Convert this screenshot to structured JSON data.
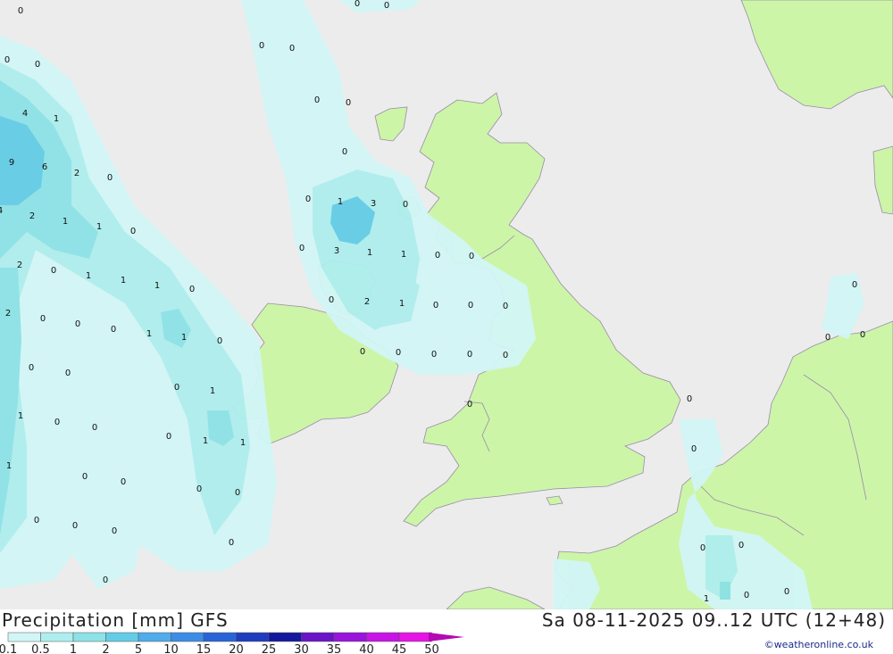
{
  "title": "Precipitation [mm] GFS",
  "datetime": "Sa 08-11-2025 09..12 UTC (12+48)",
  "credit": "©weatheronline.co.uk",
  "colors": {
    "sea": "#ececec",
    "land": "#ccf5a8",
    "border": "#9a8aa8",
    "precip_0_1": "#d2f6f6",
    "precip_0_5": "#aeeeee",
    "precip_1": "#8ce2e6",
    "precip_2": "#64cce6",
    "precip_5": "#50acea"
  },
  "legend": {
    "labels": [
      "0.1",
      "0.5",
      "1",
      "2",
      "5",
      "10",
      "15",
      "20",
      "25",
      "30",
      "35",
      "40",
      "45",
      "50"
    ],
    "colors": [
      "#d2f6f6",
      "#aeeeee",
      "#8ce2e6",
      "#64cce6",
      "#50acea",
      "#3c8ce6",
      "#2864d8",
      "#1e3cbe",
      "#14189c",
      "#6a14c8",
      "#9a14dc",
      "#c814e6",
      "#e614e6",
      "#b40ab4"
    ]
  },
  "map_labels": [
    "0",
    "0",
    "0",
    "0",
    "0",
    "0",
    "0",
    "0",
    "0",
    "4",
    "1",
    "9",
    "6",
    "2",
    "0",
    "0",
    "1",
    "3",
    "0",
    "4",
    "2",
    "1",
    "1",
    "0",
    "0",
    "3",
    "1",
    "1",
    "0",
    "0",
    "2",
    "0",
    "1",
    "1",
    "1",
    "0",
    "0",
    "2",
    "1",
    "0",
    "0",
    "0",
    "2",
    "0",
    "0",
    "1",
    "1",
    "0",
    "0",
    "0",
    "0",
    "0",
    "0",
    "0",
    "0",
    "0",
    "0",
    "0",
    "0",
    "0",
    "0",
    "1",
    "0",
    "0",
    "1",
    "1",
    "0",
    "0",
    "1",
    "0",
    "0",
    "1",
    "0",
    "0",
    "0",
    "0",
    "0",
    "0",
    "0",
    "0",
    "0",
    "0",
    "1",
    "0",
    "0",
    "0"
  ]
}
